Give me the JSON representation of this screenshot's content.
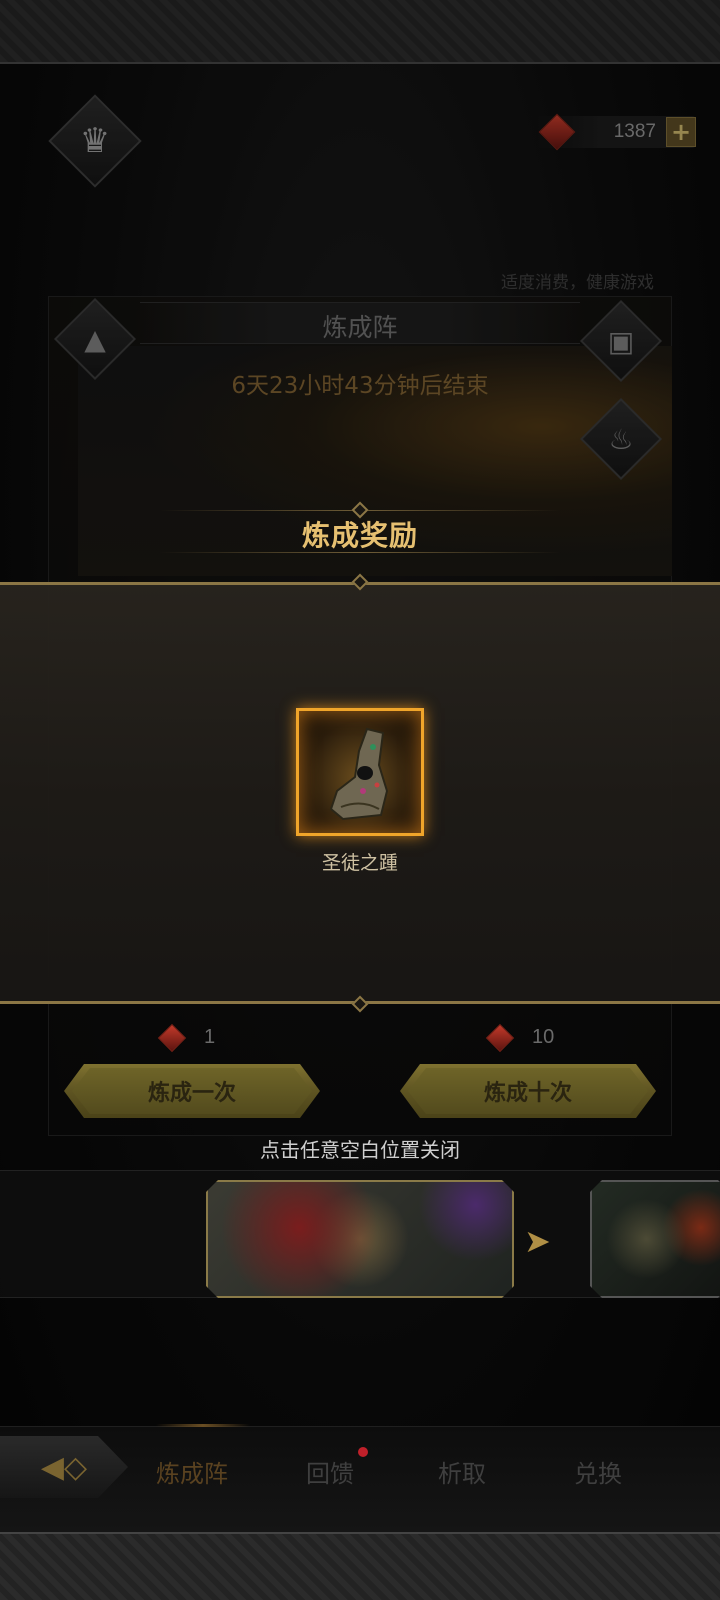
{
  "currency": {
    "value": "1387",
    "plus_label": "+",
    "icon": "red-gem-icon"
  },
  "notice": "适度消费，健康游戏",
  "panel": {
    "title": "炼成阵",
    "countdown": "6天23小时43分钟后结束"
  },
  "reward_modal": {
    "title": "炼成奖励",
    "item": {
      "name": "圣徒之踵",
      "icon": "saint-heel-relic-icon"
    },
    "close_hint": "点击任意空白位置关闭"
  },
  "craft": {
    "once": {
      "label": "炼成一次",
      "cost": "1"
    },
    "ten": {
      "label": "炼成十次",
      "cost": "10"
    }
  },
  "nav": {
    "tabs": [
      {
        "label": "炼成阵",
        "active": true
      },
      {
        "label": "回馈",
        "badge": true
      },
      {
        "label": "析取"
      },
      {
        "label": "兑换"
      }
    ]
  },
  "colors": {
    "accent_gold": "#e6c071",
    "frame_gold": "#8b7645",
    "badge_red": "#c0202a"
  }
}
